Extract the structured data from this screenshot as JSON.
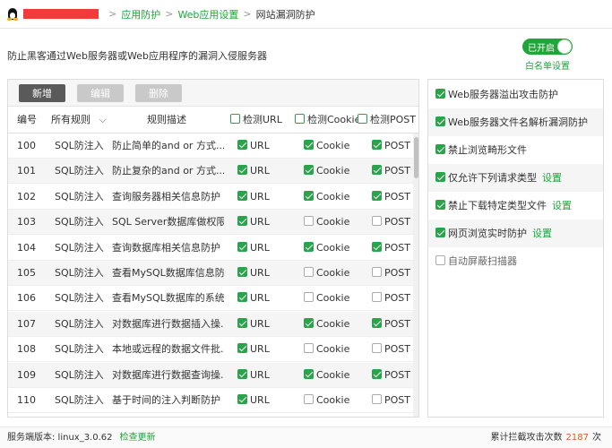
{
  "breadcrumb": {
    "items": [
      "应用防护",
      "Web应用设置",
      "网站漏洞防护"
    ],
    "separator": ">"
  },
  "header": {
    "description": "防止黑客通过Web服务器或Web应用程序的漏洞入侵服务器",
    "toggle_label": "已开启",
    "whitelist_label": "白名单设置"
  },
  "toolbar": {
    "add_label": "新增",
    "edit_label": "编辑",
    "delete_label": "删除"
  },
  "table": {
    "columns": {
      "id": "编号",
      "rule_filter": "所有规则",
      "description": "规则描述",
      "url": "检测URL",
      "cookie": "检测Cookie",
      "post": "检测POST"
    },
    "rows": [
      {
        "id": "100",
        "rule": "SQL防注入",
        "desc": "防止简单的and or 方式...",
        "url": "URL",
        "url_on": true,
        "cookie": "Cookie",
        "cookie_on": true,
        "post": "POST",
        "post_on": true
      },
      {
        "id": "101",
        "rule": "SQL防注入",
        "desc": "防止复杂的and or 方式...",
        "url": "URL",
        "url_on": true,
        "cookie": "Cookie",
        "cookie_on": true,
        "post": "POST",
        "post_on": true
      },
      {
        "id": "102",
        "rule": "SQL防注入",
        "desc": "查询服务器相关信息防护",
        "url": "URL",
        "url_on": true,
        "cookie": "Cookie",
        "cookie_on": true,
        "post": "POST",
        "post_on": true
      },
      {
        "id": "103",
        "rule": "SQL防注入",
        "desc": "SQL Server数据库做权限...",
        "url": "URL",
        "url_on": true,
        "cookie": "Cookie",
        "cookie_on": false,
        "post": "POST",
        "post_on": false
      },
      {
        "id": "104",
        "rule": "SQL防注入",
        "desc": "查询数据库相关信息防护",
        "url": "URL",
        "url_on": true,
        "cookie": "Cookie",
        "cookie_on": true,
        "post": "POST",
        "post_on": true
      },
      {
        "id": "105",
        "rule": "SQL防注入",
        "desc": "查看MySQL数据库信息防...",
        "url": "URL",
        "url_on": true,
        "cookie": "Cookie",
        "cookie_on": false,
        "post": "POST",
        "post_on": false
      },
      {
        "id": "106",
        "rule": "SQL防注入",
        "desc": "查看MySQL数据库的系统...",
        "url": "URL",
        "url_on": true,
        "cookie": "Cookie",
        "cookie_on": false,
        "post": "POST",
        "post_on": false
      },
      {
        "id": "107",
        "rule": "SQL防注入",
        "desc": "对数据库进行数据插入操...",
        "url": "URL",
        "url_on": true,
        "cookie": "Cookie",
        "cookie_on": true,
        "post": "POST",
        "post_on": true
      },
      {
        "id": "108",
        "rule": "SQL防注入",
        "desc": "本地或远程的数据文件批...",
        "url": "URL",
        "url_on": true,
        "cookie": "Cookie",
        "cookie_on": false,
        "post": "POST",
        "post_on": false
      },
      {
        "id": "109",
        "rule": "SQL防注入",
        "desc": "对数据库进行数据查询操...",
        "url": "URL",
        "url_on": true,
        "cookie": "Cookie",
        "cookie_on": true,
        "post": "POST",
        "post_on": true
      },
      {
        "id": "110",
        "rule": "SQL防注入",
        "desc": "基于时间的注入判断防护",
        "url": "URL",
        "url_on": true,
        "cookie": "Cookie",
        "cookie_on": false,
        "post": "POST",
        "post_on": false
      }
    ]
  },
  "options": [
    {
      "label": "Web服务器溢出攻击防护",
      "checked": true,
      "setting": ""
    },
    {
      "label": "Web服务器文件名解析漏洞防护",
      "checked": true,
      "setting": ""
    },
    {
      "label": "禁止浏览畸形文件",
      "checked": true,
      "setting": ""
    },
    {
      "label": "仅允许下列请求类型",
      "checked": true,
      "setting": "设置"
    },
    {
      "label": "禁止下载特定类型文件",
      "checked": true,
      "setting": "设置"
    },
    {
      "label": "网页浏览实时防护",
      "checked": true,
      "setting": "设置"
    },
    {
      "label": "自动屏蔽扫描器",
      "checked": false,
      "setting": ""
    }
  ],
  "footer": {
    "version_label": "服务端版本: linux_3.0.62",
    "check_update": "检查更新",
    "attack_label": "累计拦截攻击次数",
    "attack_count": "2187",
    "attack_unit": "次"
  },
  "colors": {
    "accent": "#20a53a",
    "checkbox": "#2aa44a",
    "count": "#e05a2a",
    "redaction": "#ef3b3b"
  }
}
